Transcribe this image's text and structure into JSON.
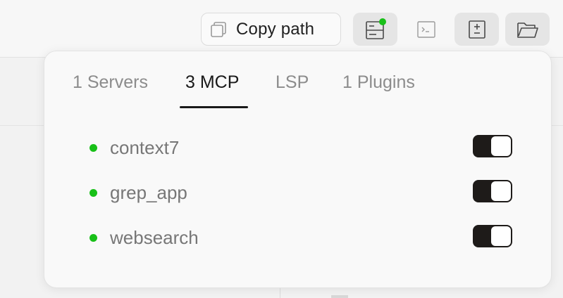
{
  "toolbar": {
    "copy_path_label": "Copy path",
    "icons": {
      "copy": "copy-icon",
      "status": "status-list-icon",
      "terminal": "terminal-icon",
      "review": "plus-minus-icon",
      "folder": "folder-open-icon"
    }
  },
  "popover": {
    "tabs": [
      {
        "label": "1 Servers",
        "selected": false
      },
      {
        "label": "3 MCP",
        "selected": true
      },
      {
        "label": "LSP",
        "selected": false
      },
      {
        "label": "1 Plugins",
        "selected": false
      }
    ],
    "servers": [
      {
        "name": "context7",
        "status": "connected",
        "enabled": true
      },
      {
        "name": "grep_app",
        "status": "connected",
        "enabled": true
      },
      {
        "name": "websearch",
        "status": "connected",
        "enabled": true
      }
    ]
  },
  "colors": {
    "status_green": "#18c018",
    "toggle_on": "#1e1b19",
    "tab_selected": "#1a1a1a",
    "tab_inactive": "#8c8c8c"
  }
}
